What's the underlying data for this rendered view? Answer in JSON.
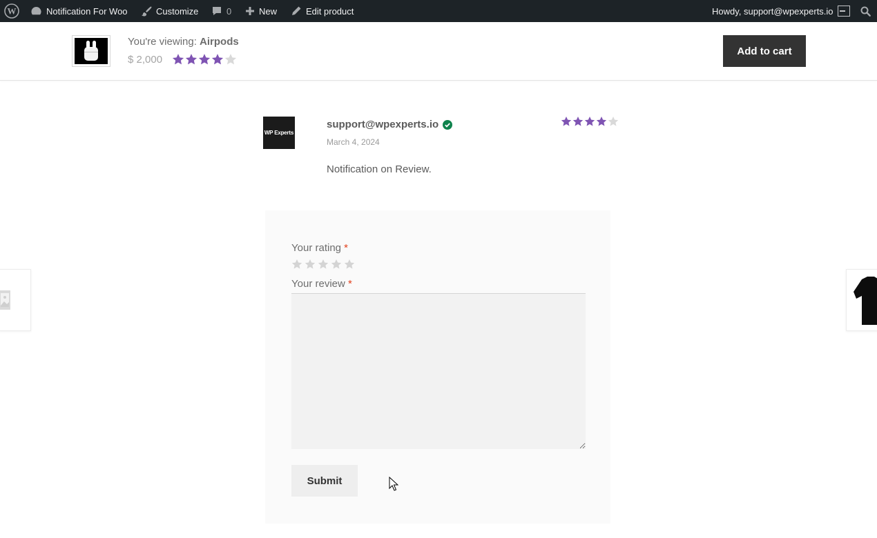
{
  "adminbar": {
    "site_name": "Notification For Woo",
    "customize": "Customize",
    "comments_count": "0",
    "new_label": "New",
    "edit_label": "Edit product",
    "howdy": "Howdy, support@wpexperts.io"
  },
  "sticky": {
    "viewing_prefix": "You're viewing:",
    "product_name": "Airpods",
    "price": "$ 2,000",
    "rating": 4,
    "rating_max": 5,
    "add_to_cart": "Add to cart"
  },
  "review": {
    "avatar_text": "WP Experts",
    "author": "support@wpexperts.io",
    "date": "March 4, 2024",
    "text": "Notification on Review.",
    "rating": 4,
    "rating_max": 5
  },
  "form": {
    "rating_label": "Your rating",
    "review_label": "Your review",
    "required_mark": "*",
    "submit": "Submit"
  },
  "colors": {
    "star_filled": "#7f54b3",
    "star_empty": "#d9d9d9",
    "verified": "#0f834d",
    "adminbar_bg": "#1d2327"
  }
}
